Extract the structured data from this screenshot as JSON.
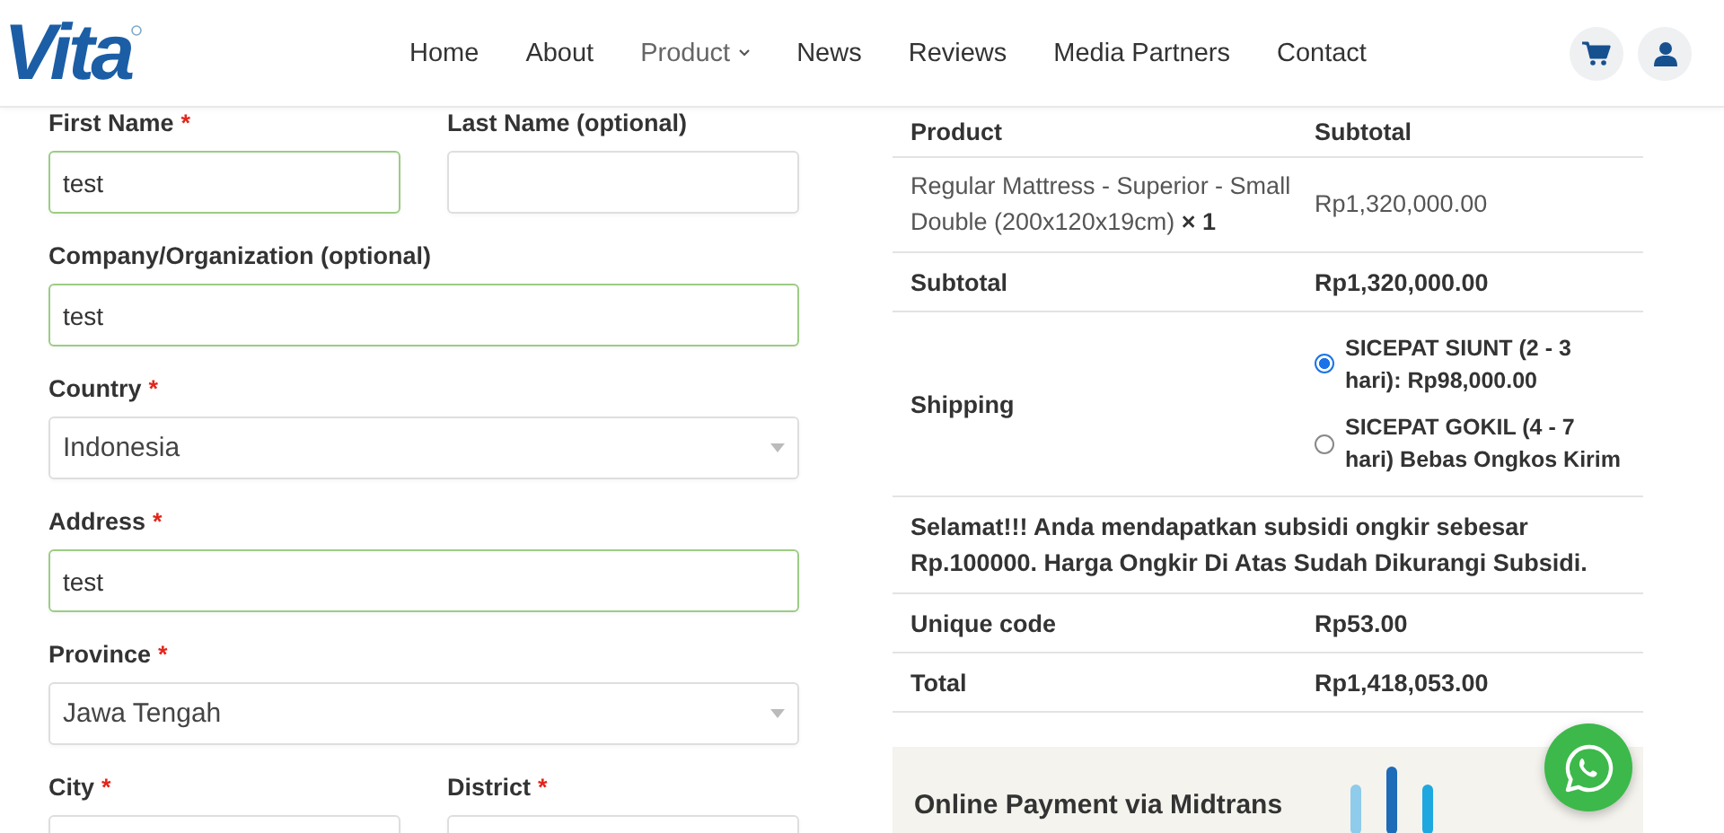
{
  "header": {
    "logo": "Vita",
    "nav": [
      {
        "label": "Home",
        "dropdown": false
      },
      {
        "label": "About",
        "dropdown": false
      },
      {
        "label": "Product",
        "dropdown": true
      },
      {
        "label": "News",
        "dropdown": false
      },
      {
        "label": "Reviews",
        "dropdown": false
      },
      {
        "label": "Media Partners",
        "dropdown": false
      },
      {
        "label": "Contact",
        "dropdown": false
      }
    ]
  },
  "form": {
    "rows": [
      [
        {
          "label": "First Name",
          "mark": "*",
          "kind": "text",
          "value": "test",
          "valid": true
        },
        {
          "label": "Last Name (optional)",
          "kind": "text",
          "valid": false
        }
      ],
      [
        {
          "label": "Company/Organization (optional)",
          "kind": "text",
          "value": "test",
          "valid": true
        }
      ],
      [
        {
          "label": "Country",
          "mark": "*",
          "kind": "select",
          "value": "Indonesia",
          "valid": false
        }
      ],
      [
        {
          "label": "Address",
          "mark": "*",
          "kind": "text",
          "value": "test",
          "valid": true
        }
      ],
      [
        {
          "label": "Province",
          "mark": "*",
          "kind": "select",
          "value": "Jawa Tengah",
          "valid": false
        }
      ],
      [
        {
          "label": "City",
          "mark": "*",
          "kind": "text",
          "valid": false
        },
        {
          "label": "District",
          "mark": "*",
          "kind": "text",
          "valid": false
        }
      ]
    ]
  },
  "order": {
    "columns": [
      "Product",
      "Subtotal"
    ],
    "rows": [
      {
        "kind": "item",
        "product": "Regular Mattress - Superior - Small Double (200x120x19cm)",
        "qty": "× 1",
        "amount": "Rp1,320,000.00"
      },
      {
        "kind": "total",
        "label": "Subtotal",
        "amount": "Rp1,320,000.00"
      },
      {
        "kind": "shipping",
        "label": "Shipping",
        "options": [
          {
            "label": "SICEPAT SIUNT (2 - 3 hari): Rp98,000.00",
            "selected": true
          },
          {
            "label": "SICEPAT GOKIL (4 - 7 hari) Bebas Ongkos Kirim",
            "selected": false
          }
        ]
      },
      {
        "kind": "notice",
        "text": "Selamat!!! Anda mendapatkan subsidi ongkir sebesar Rp.100000. Harga Ongkir Di Atas Sudah Dikurangi Subsidi."
      },
      {
        "kind": "total",
        "label": "Unique code",
        "amount": "Rp53.00"
      },
      {
        "kind": "total",
        "label": "Total",
        "amount": "Rp1,418,053.00"
      }
    ],
    "payment": {
      "title": "Online Payment via Midtrans"
    }
  }
}
